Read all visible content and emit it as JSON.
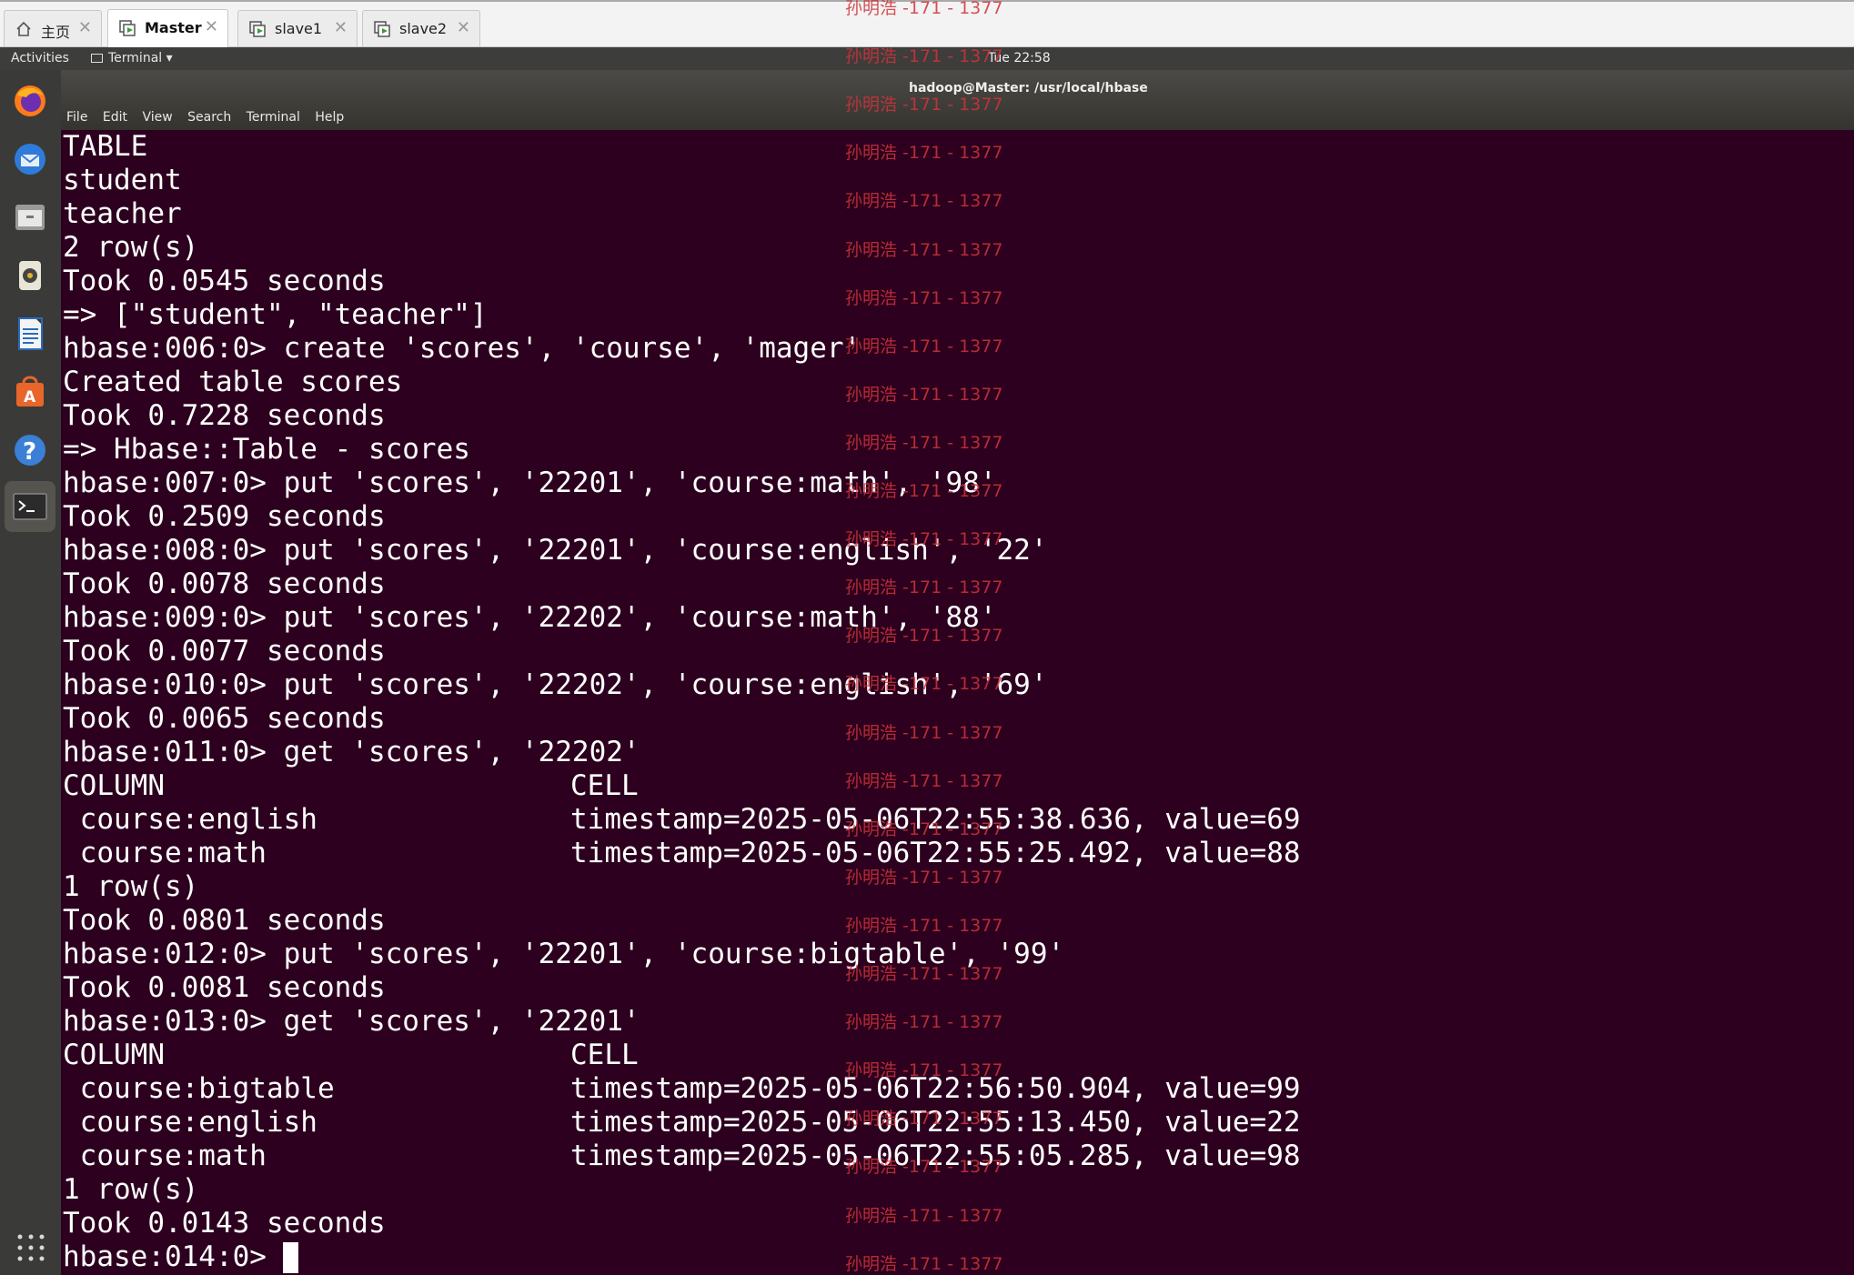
{
  "vm_tabs": [
    {
      "label": "主页",
      "icon": "home-icon",
      "active": false
    },
    {
      "label": "Master",
      "icon": "vm-running-icon",
      "active": true
    },
    {
      "label": "slave1",
      "icon": "vm-running-icon",
      "active": false
    },
    {
      "label": "slave2",
      "icon": "vm-running-icon",
      "active": false
    }
  ],
  "topbar": {
    "activities": "Activities",
    "app_menu": "Terminal ▾",
    "clock": "Tue 22:58"
  },
  "window": {
    "title": "hadoop@Master: /usr/local/hbase",
    "menu": [
      "File",
      "Edit",
      "View",
      "Search",
      "Terminal",
      "Help"
    ]
  },
  "dock": [
    "firefox-icon",
    "thunderbird-icon",
    "files-icon",
    "rhythmbox-icon",
    "writer-icon",
    "software-icon",
    "help-icon",
    "terminal-icon",
    "show-apps-icon"
  ],
  "terminal": {
    "lines": [
      "TABLE",
      "student",
      "teacher",
      "2 row(s)",
      "Took 0.0545 seconds",
      "=> [\"student\", \"teacher\"]",
      "hbase:006:0> create 'scores', 'course', 'mager'",
      "Created table scores",
      "Took 0.7228 seconds",
      "=> Hbase::Table - scores",
      "hbase:007:0> put 'scores', '22201', 'course:math', '98'",
      "Took 0.2509 seconds",
      "hbase:008:0> put 'scores', '22201', 'course:english', '22'",
      "Took 0.0078 seconds",
      "hbase:009:0> put 'scores', '22202', 'course:math', '88'",
      "Took 0.0077 seconds",
      "hbase:010:0> put 'scores', '22202', 'course:english', '69'",
      "Took 0.0065 seconds",
      "hbase:011:0> get 'scores', '22202'",
      "COLUMN",
      " course:english",
      " course:math",
      "1 row(s)",
      "Took 0.0801 seconds",
      "hbase:012:0> put 'scores', '22201', 'course:bigtable', '99'",
      "Took 0.0081 seconds",
      "hbase:013:0> get 'scores', '22201'",
      "COLUMN",
      " course:bigtable",
      " course:english",
      " course:math",
      "1 row(s)",
      "Took 0.0143 seconds",
      "hbase:014:0> "
    ],
    "cells": [
      {
        "row": 19,
        "text": "CELL"
      },
      {
        "row": 20,
        "text": "timestamp=2025-05-06T22:55:38.636, value=69"
      },
      {
        "row": 21,
        "text": "timestamp=2025-05-06T22:55:25.492, value=88"
      },
      {
        "row": 27,
        "text": "CELL"
      },
      {
        "row": 28,
        "text": "timestamp=2025-05-06T22:56:50.904, value=99"
      },
      {
        "row": 29,
        "text": "timestamp=2025-05-06T22:55:13.450, value=22"
      },
      {
        "row": 30,
        "text": "timestamp=2025-05-06T22:55:05.285, value=98"
      }
    ]
  },
  "watermark": "孙明浩 -171 - 1377",
  "colors": {
    "terminal_bg": "#2c001e",
    "terminal_fg": "#ffffff",
    "watermark": "#d0333a"
  }
}
